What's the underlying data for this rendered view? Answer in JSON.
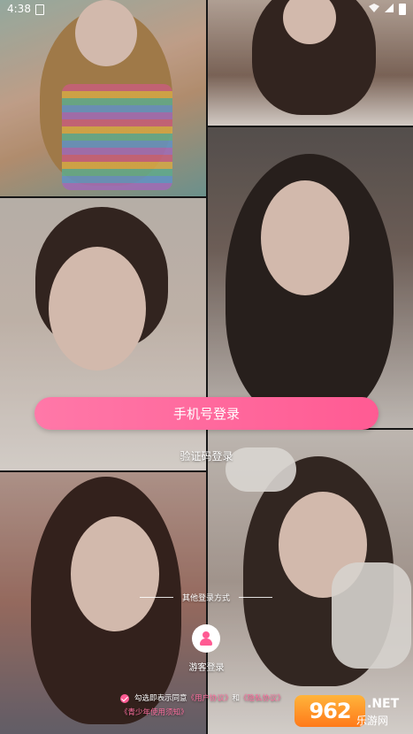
{
  "status_bar": {
    "time": "4:38"
  },
  "buttons": {
    "phone_login": "手机号登录",
    "code_login": "验证码登录"
  },
  "other_login": {
    "title": "其他登录方式",
    "guest_label": "游客登录"
  },
  "agreement": {
    "prefix": "勾选即表示同意",
    "user_agreement": "《用户协议》",
    "and": "和",
    "privacy_policy": "《隐私协议》",
    "minor_notice": "《青少年使用须知》"
  },
  "watermark": {
    "number": "962",
    "suffix": ".NET",
    "name": "乐游网"
  },
  "colors": {
    "accent": "#ff5b93",
    "accent_light": "#ff78a8"
  }
}
